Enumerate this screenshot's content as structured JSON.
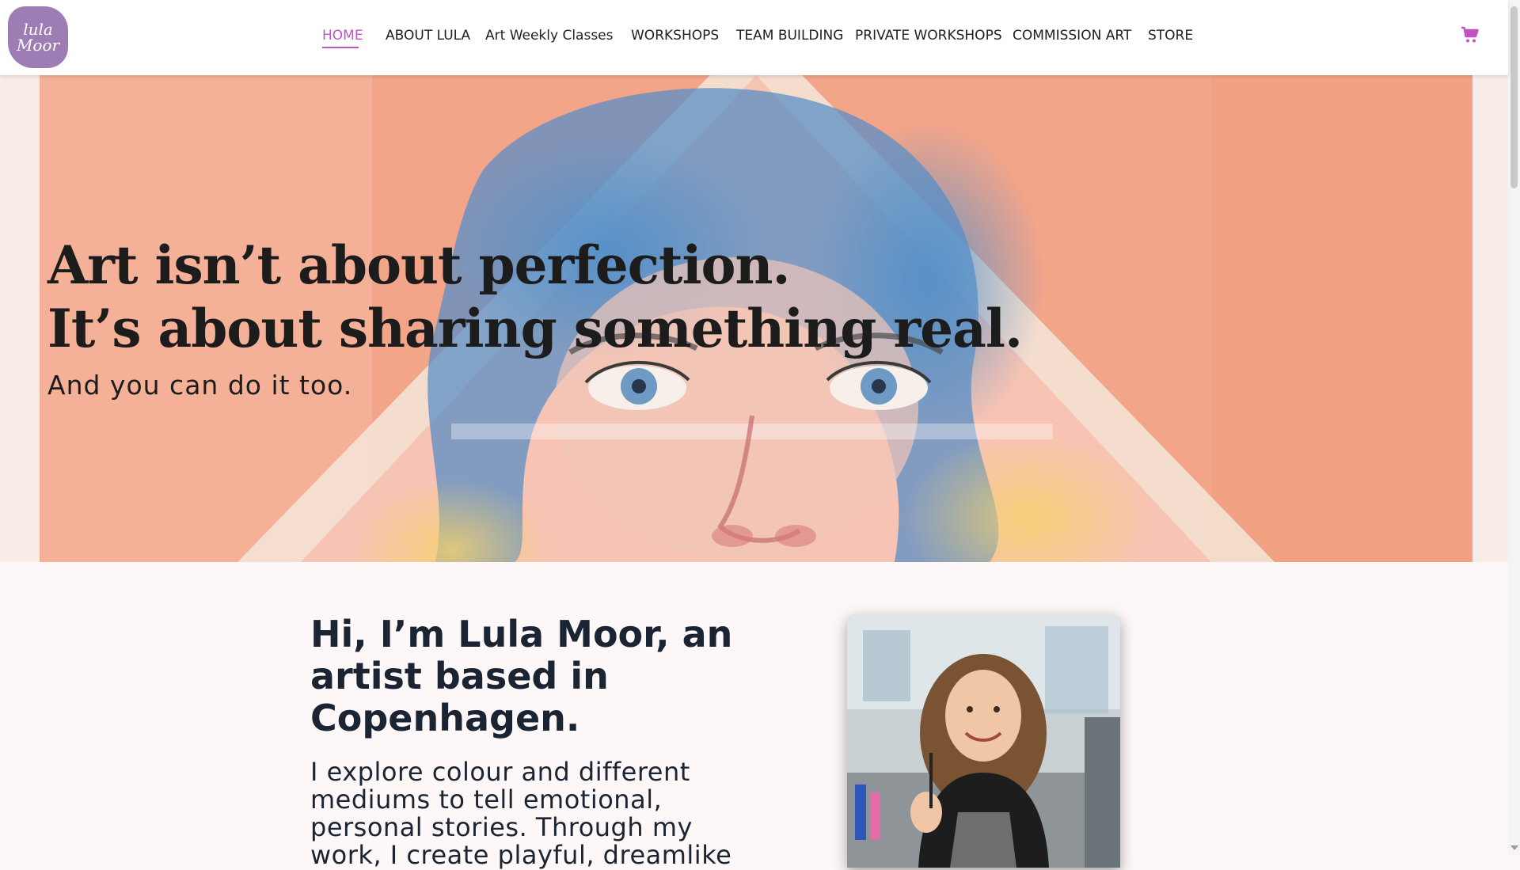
{
  "logo": {
    "text_line1": "lula",
    "text_line2": "Moor"
  },
  "nav": {
    "items": [
      {
        "label": "HOME",
        "active": true
      },
      {
        "label": "ABOUT LULA"
      },
      {
        "label": "Art Weekly Classes"
      },
      {
        "label": "WORKSHOPS"
      },
      {
        "label": "TEAM BUILDING"
      },
      {
        "label": "PRIVATE WORKSHOPS"
      },
      {
        "label": "COMMISSION ART"
      },
      {
        "label": "STORE"
      }
    ],
    "active_color": "#c154c1",
    "cart_icon": "shopping-cart-icon"
  },
  "hero": {
    "title_line1": "Art isn’t about perfection.",
    "title_line2": "It’s about sharing something real.",
    "subtitle": "And you can do it too."
  },
  "intro": {
    "heading_line1": "Hi, I’m Lula Moor, an",
    "heading_line2": "artist based in",
    "heading_line3": "Copenhagen.",
    "text_line1": "I explore colour and different",
    "text_line2": "mediums to tell emotional,",
    "text_line3": "personal stories. Through my",
    "text_line4": "work, I create playful, dreamlike"
  },
  "colors": {
    "accent": "#c154c1",
    "logo_bg": "#9d7db4",
    "heading": "#1b2433",
    "hero_bg": "#f8ece8"
  }
}
